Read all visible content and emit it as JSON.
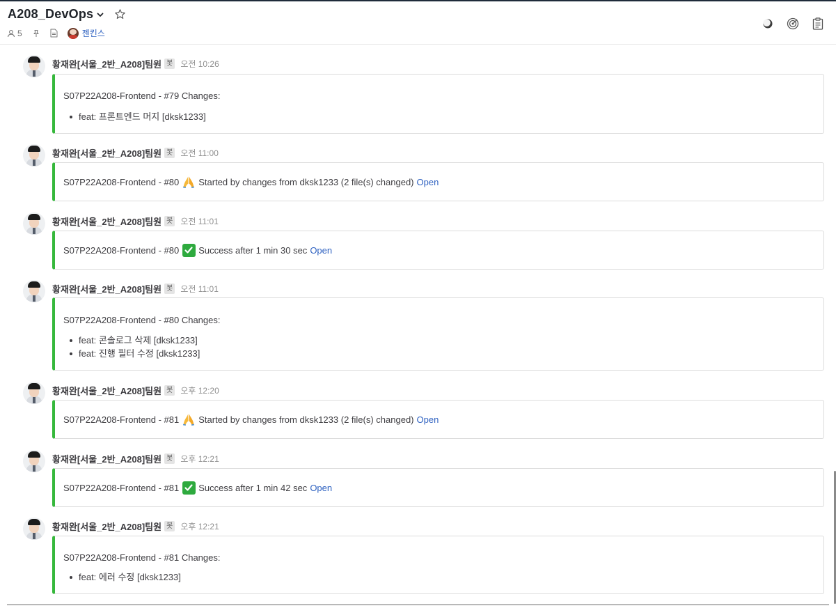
{
  "channel": {
    "name": "A208_DevOps",
    "member_count": "5",
    "bookmark_label": "젠킨스"
  },
  "header_icons": [
    "status-icon",
    "focus-target-icon",
    "clipboard-icon"
  ],
  "colors": {
    "attachment_bar": "#36b83c",
    "link": "#2f62c1",
    "success_check": "#2eaa3e"
  },
  "posts": [
    {
      "author": "황재완[서울_2반_A208]팀원",
      "badge": "봇",
      "time": "오전 10:26",
      "text": "S07P22A208-Frontend - #79 Changes:",
      "items": [
        "feat: 프론트엔드 머지 [dksk1233]"
      ]
    },
    {
      "author": "황재완[서울_2반_A208]팀원",
      "badge": "봇",
      "time": "오전 11:00",
      "prefix": "S07P22A208-Frontend - #80",
      "emoji": "pray-icon",
      "suffix": "Started by changes from dksk1233 (2 file(s) changed)",
      "link": "Open"
    },
    {
      "author": "황재완[서울_2반_A208]팀원",
      "badge": "봇",
      "time": "오전 11:01",
      "prefix": "S07P22A208-Frontend - #80",
      "emoji": "check-mark-icon",
      "suffix": "Success after 1 min 30 sec",
      "link": "Open"
    },
    {
      "author": "황재완[서울_2반_A208]팀원",
      "badge": "봇",
      "time": "오전 11:01",
      "text": "S07P22A208-Frontend - #80 Changes:",
      "items": [
        "feat: 콘솔로그 삭제 [dksk1233]",
        "feat: 진행 필터 수정 [dksk1233]"
      ]
    },
    {
      "author": "황재완[서울_2반_A208]팀원",
      "badge": "봇",
      "time": "오후 12:20",
      "prefix": "S07P22A208-Frontend - #81",
      "emoji": "pray-icon",
      "suffix": "Started by changes from dksk1233 (2 file(s) changed)",
      "link": "Open"
    },
    {
      "author": "황재완[서울_2반_A208]팀원",
      "badge": "봇",
      "time": "오후 12:21",
      "prefix": "S07P22A208-Frontend - #81",
      "emoji": "check-mark-icon",
      "suffix": "Success after 1 min 42 sec",
      "link": "Open"
    },
    {
      "author": "황재완[서울_2반_A208]팀원",
      "badge": "봇",
      "time": "오후 12:21",
      "text": "S07P22A208-Frontend - #81 Changes:",
      "items": [
        "feat: 에러 수정 [dksk1233]"
      ]
    }
  ]
}
